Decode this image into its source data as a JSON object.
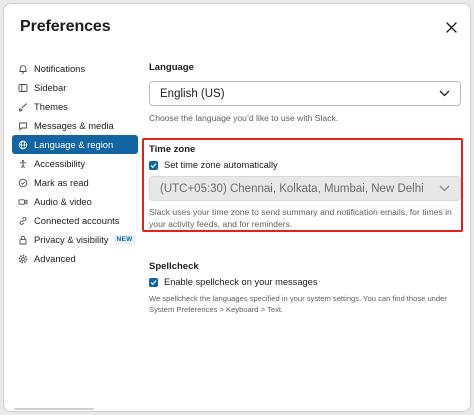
{
  "window": {
    "title": "Preferences",
    "close_label": "close"
  },
  "sidebar": {
    "items": [
      {
        "label": "Notifications",
        "icon": "bell-icon",
        "active": false
      },
      {
        "label": "Sidebar",
        "icon": "sidebar-icon",
        "active": false
      },
      {
        "label": "Themes",
        "icon": "brush-icon",
        "active": false
      },
      {
        "label": "Messages & media",
        "icon": "message-icon",
        "active": false
      },
      {
        "label": "Language & region",
        "icon": "globe-icon",
        "active": true
      },
      {
        "label": "Accessibility",
        "icon": "accessibility-icon",
        "active": false
      },
      {
        "label": "Mark as read",
        "icon": "check-circle-icon",
        "active": false
      },
      {
        "label": "Audio & video",
        "icon": "video-icon",
        "active": false
      },
      {
        "label": "Connected accounts",
        "icon": "link-icon",
        "active": false
      },
      {
        "label": "Privacy & visibility",
        "icon": "lock-icon",
        "active": false,
        "badge": "NEW"
      },
      {
        "label": "Advanced",
        "icon": "gear-icon",
        "active": false
      }
    ]
  },
  "language": {
    "heading": "Language",
    "selected": "English (US)",
    "help": "Choose the language you’d like to use with Slack."
  },
  "timezone": {
    "heading": "Time zone",
    "auto_label": "Set time zone automatically",
    "auto_checked": true,
    "selected": "(UTC+05:30) Chennai, Kolkata, Mumbai, New Delhi",
    "help": "Slack uses your time zone to send summary and notification emails, for times in your activity feeds, and for reminders."
  },
  "spellcheck": {
    "heading": "Spellcheck",
    "enable_label": "Enable spellcheck on your messages",
    "enabled": true,
    "help": "We spellcheck the languages specified in your system settings. You can find those under System Preferences > Keyboard > Text."
  },
  "colors": {
    "accent": "#1264a3",
    "highlight": "#e0241b"
  }
}
